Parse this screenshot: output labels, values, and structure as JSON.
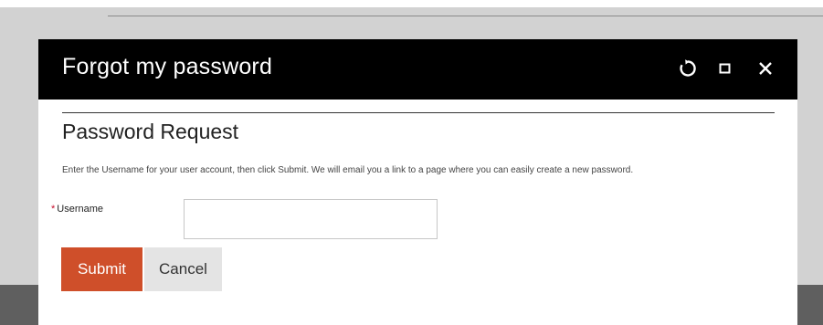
{
  "dialog": {
    "title": "Forgot my password",
    "controls": {
      "refresh_icon": "refresh-icon",
      "maximize_icon": "maximize-icon",
      "close_icon": "close-icon"
    }
  },
  "form": {
    "heading": "Password Request",
    "instructions": "Enter the Username for your user account, then click Submit. We will email you a link to a page where you can easily create a new password.",
    "username": {
      "required_marker": "*",
      "label": "Username",
      "value": ""
    },
    "submit_label": "Submit",
    "cancel_label": "Cancel"
  },
  "colors": {
    "titlebar": "#000000",
    "submit": "#cf4f2a",
    "cancel": "#e4e4e4",
    "required": "#c8102e"
  }
}
